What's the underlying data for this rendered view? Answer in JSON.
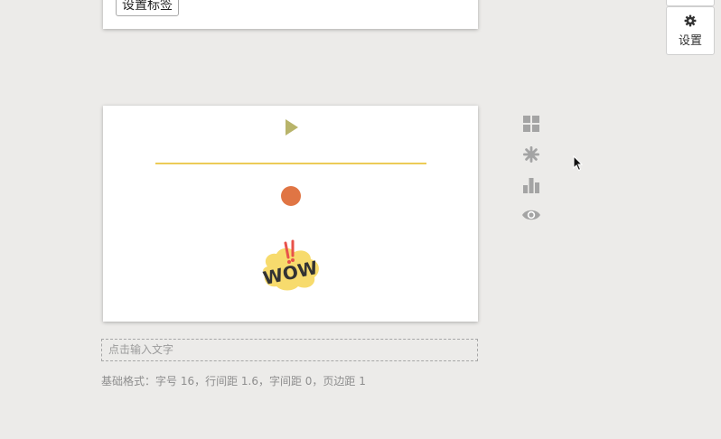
{
  "top_card": {
    "tag_button_label": "设置标签"
  },
  "settings": {
    "label": "设置",
    "icon": "gear-icon"
  },
  "canvas": {
    "elements": [
      {
        "name": "play-triangle",
        "color": "#b8b46a"
      },
      {
        "name": "horizontal-line",
        "color": "#eccb57"
      },
      {
        "name": "circle-dot",
        "color": "#e07544"
      },
      {
        "name": "wow-sticker",
        "text": "WOW",
        "color": "#f7db6d",
        "accent": "#e8524a"
      }
    ]
  },
  "side_toolbar": [
    {
      "icon": "grid-icon"
    },
    {
      "icon": "sparkle-icon"
    },
    {
      "icon": "bar-chart-icon"
    },
    {
      "icon": "eye-icon"
    }
  ],
  "text_input": {
    "placeholder": "点击输入文字"
  },
  "format_info": "基础格式：字号 16，行间距 1.6，字间距 0，页边距 1",
  "colors": {
    "background": "#ecebe9",
    "card": "#ffffff",
    "tool_gray": "#a4a4a4"
  }
}
